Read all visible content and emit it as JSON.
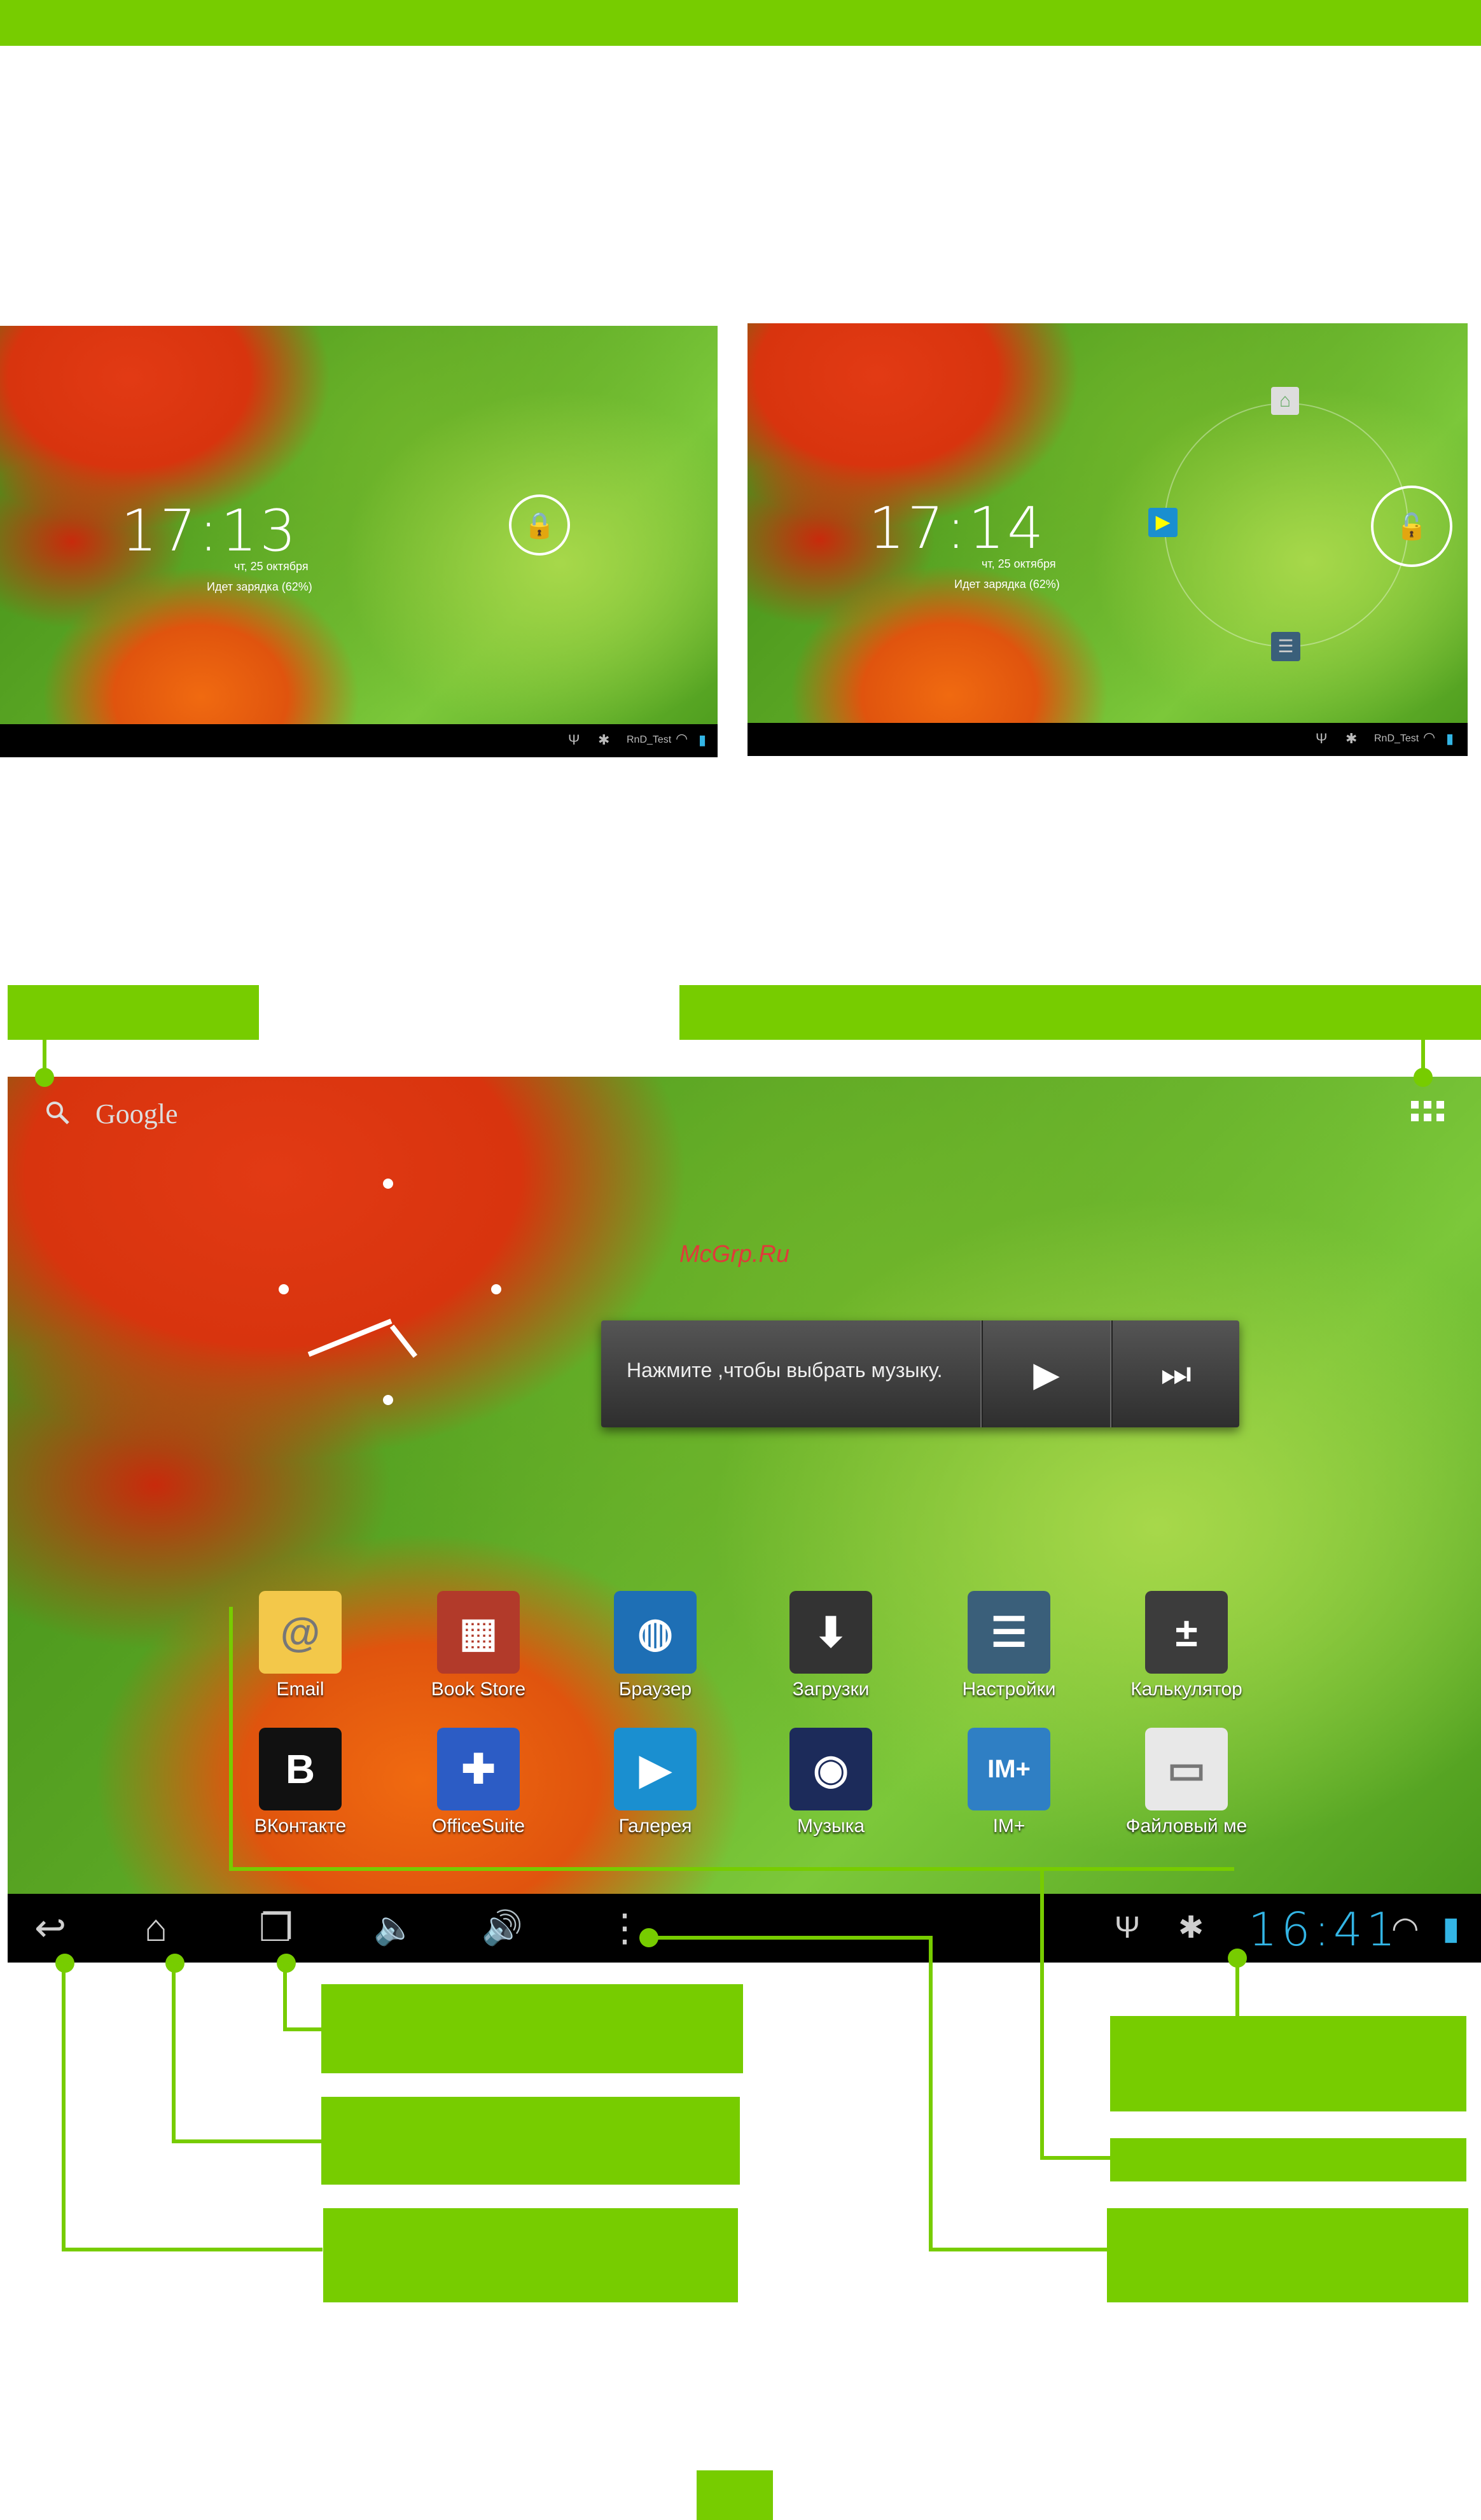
{
  "lock_left": {
    "time": "17:13",
    "date": "чт, 25 октября",
    "charge": "Идет зарядка (62%)",
    "wifi_name": "RnD_Test"
  },
  "lock_right": {
    "time": "17:14",
    "date": "чт, 25 октября",
    "charge": "Идет зарядка (62%)",
    "wifi_name": "RnD_Test"
  },
  "home": {
    "search_label": "Google",
    "watermark": "McGrp.Ru",
    "music_label": "Нажмите ,чтобы выбрать музыку.",
    "apps_row1": [
      {
        "label": "Email",
        "icon": "email-icon",
        "color": "#f3c84a",
        "glyph": "@"
      },
      {
        "label": "Book Store",
        "icon": "book-store-icon",
        "color": "#b23a2a",
        "glyph": "▦"
      },
      {
        "label": "Браузер",
        "icon": "browser-globe-icon",
        "color": "#1e6fb5",
        "glyph": "◍"
      },
      {
        "label": "Загрузки",
        "icon": "downloads-icon",
        "color": "#333333",
        "glyph": "⬇"
      },
      {
        "label": "Настройки",
        "icon": "settings-icon",
        "color": "#3a5f7a",
        "glyph": "☰"
      },
      {
        "label": "Калькулятор",
        "icon": "calculator-icon",
        "color": "#3c3c3c",
        "glyph": "±"
      }
    ],
    "apps_row2": [
      {
        "label": "ВКонтакте",
        "icon": "vkontakte-icon",
        "color": "#111111",
        "glyph": "B"
      },
      {
        "label": "OfficeSuite",
        "icon": "officesuite-icon",
        "color": "#2c5cc5",
        "glyph": "✚"
      },
      {
        "label": "Галерея",
        "icon": "gallery-icon",
        "color": "#1a8fd0",
        "glyph": "▶"
      },
      {
        "label": "Музыка",
        "icon": "music-icon",
        "color": "#1c2b5a",
        "glyph": "◉"
      },
      {
        "label": "IM+",
        "icon": "im-plus-icon",
        "color": "#2f7fc4",
        "glyph": "IM+"
      },
      {
        "label": "Файловый ме",
        "icon": "file-manager-icon",
        "color": "#e8e8e8",
        "glyph": "▭"
      }
    ],
    "clock": "16:41"
  },
  "colors": {
    "accent": "#77cc00",
    "clock": "#33b5e5"
  }
}
